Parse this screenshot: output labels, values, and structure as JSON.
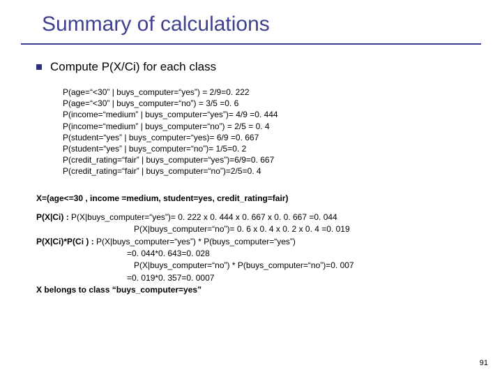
{
  "title": "Summary of calculations",
  "subhead": "Compute P(X/Ci) for each class",
  "probs": {
    "p1": "P(age=“<30” | buys_computer=“yes”)  = 2/9=0. 222",
    "p2": "P(age=“<30” | buys_computer=“no”) = 3/5 =0. 6",
    "p3": "P(income=“medium” | buys_computer=“yes”)= 4/9 =0. 444",
    "p4": "P(income=“medium” | buys_computer=“no”) = 2/5 = 0. 4",
    "p5": "P(student=“yes” | buys_computer=“yes)= 6/9 =0. 667",
    "p6": "P(student=“yes” | buys_computer=“no”)= 1/5=0. 2",
    "p7": "P(credit_rating=“fair” | buys_computer=“yes”)=6/9=0. 667",
    "p8": "P(credit_rating=“fair” | buys_computer=“no”)=2/5=0. 4"
  },
  "calc": {
    "xdef": "X=(age<=30 , income =medium, student=yes, credit_rating=fair)",
    "line1a": "P(X|Ci) : ",
    "line1b": "P(X|buys_computer=“yes”)= 0. 222 x 0. 444 x 0. 667 x 0. 0. 667 =0. 044",
    "line2": "P(X|buys_computer=“no”)= 0. 6 x 0. 4 x 0. 2 x 0. 4 =0. 019",
    "line3a": "P(X|Ci)*P(Ci ) : ",
    "line3b": "P(X|buys_computer=“yes”) * P(buys_computer=“yes”)",
    "line4": "=0. 044*0. 643=0. 028",
    "line5": "P(X|buys_computer=“no”) * P(buys_computer=“no”)=0. 007",
    "line6": "=0. 019*0. 357=0. 0007",
    "conclusion": "X belongs to  class “buys_computer=yes”"
  },
  "page": "91"
}
